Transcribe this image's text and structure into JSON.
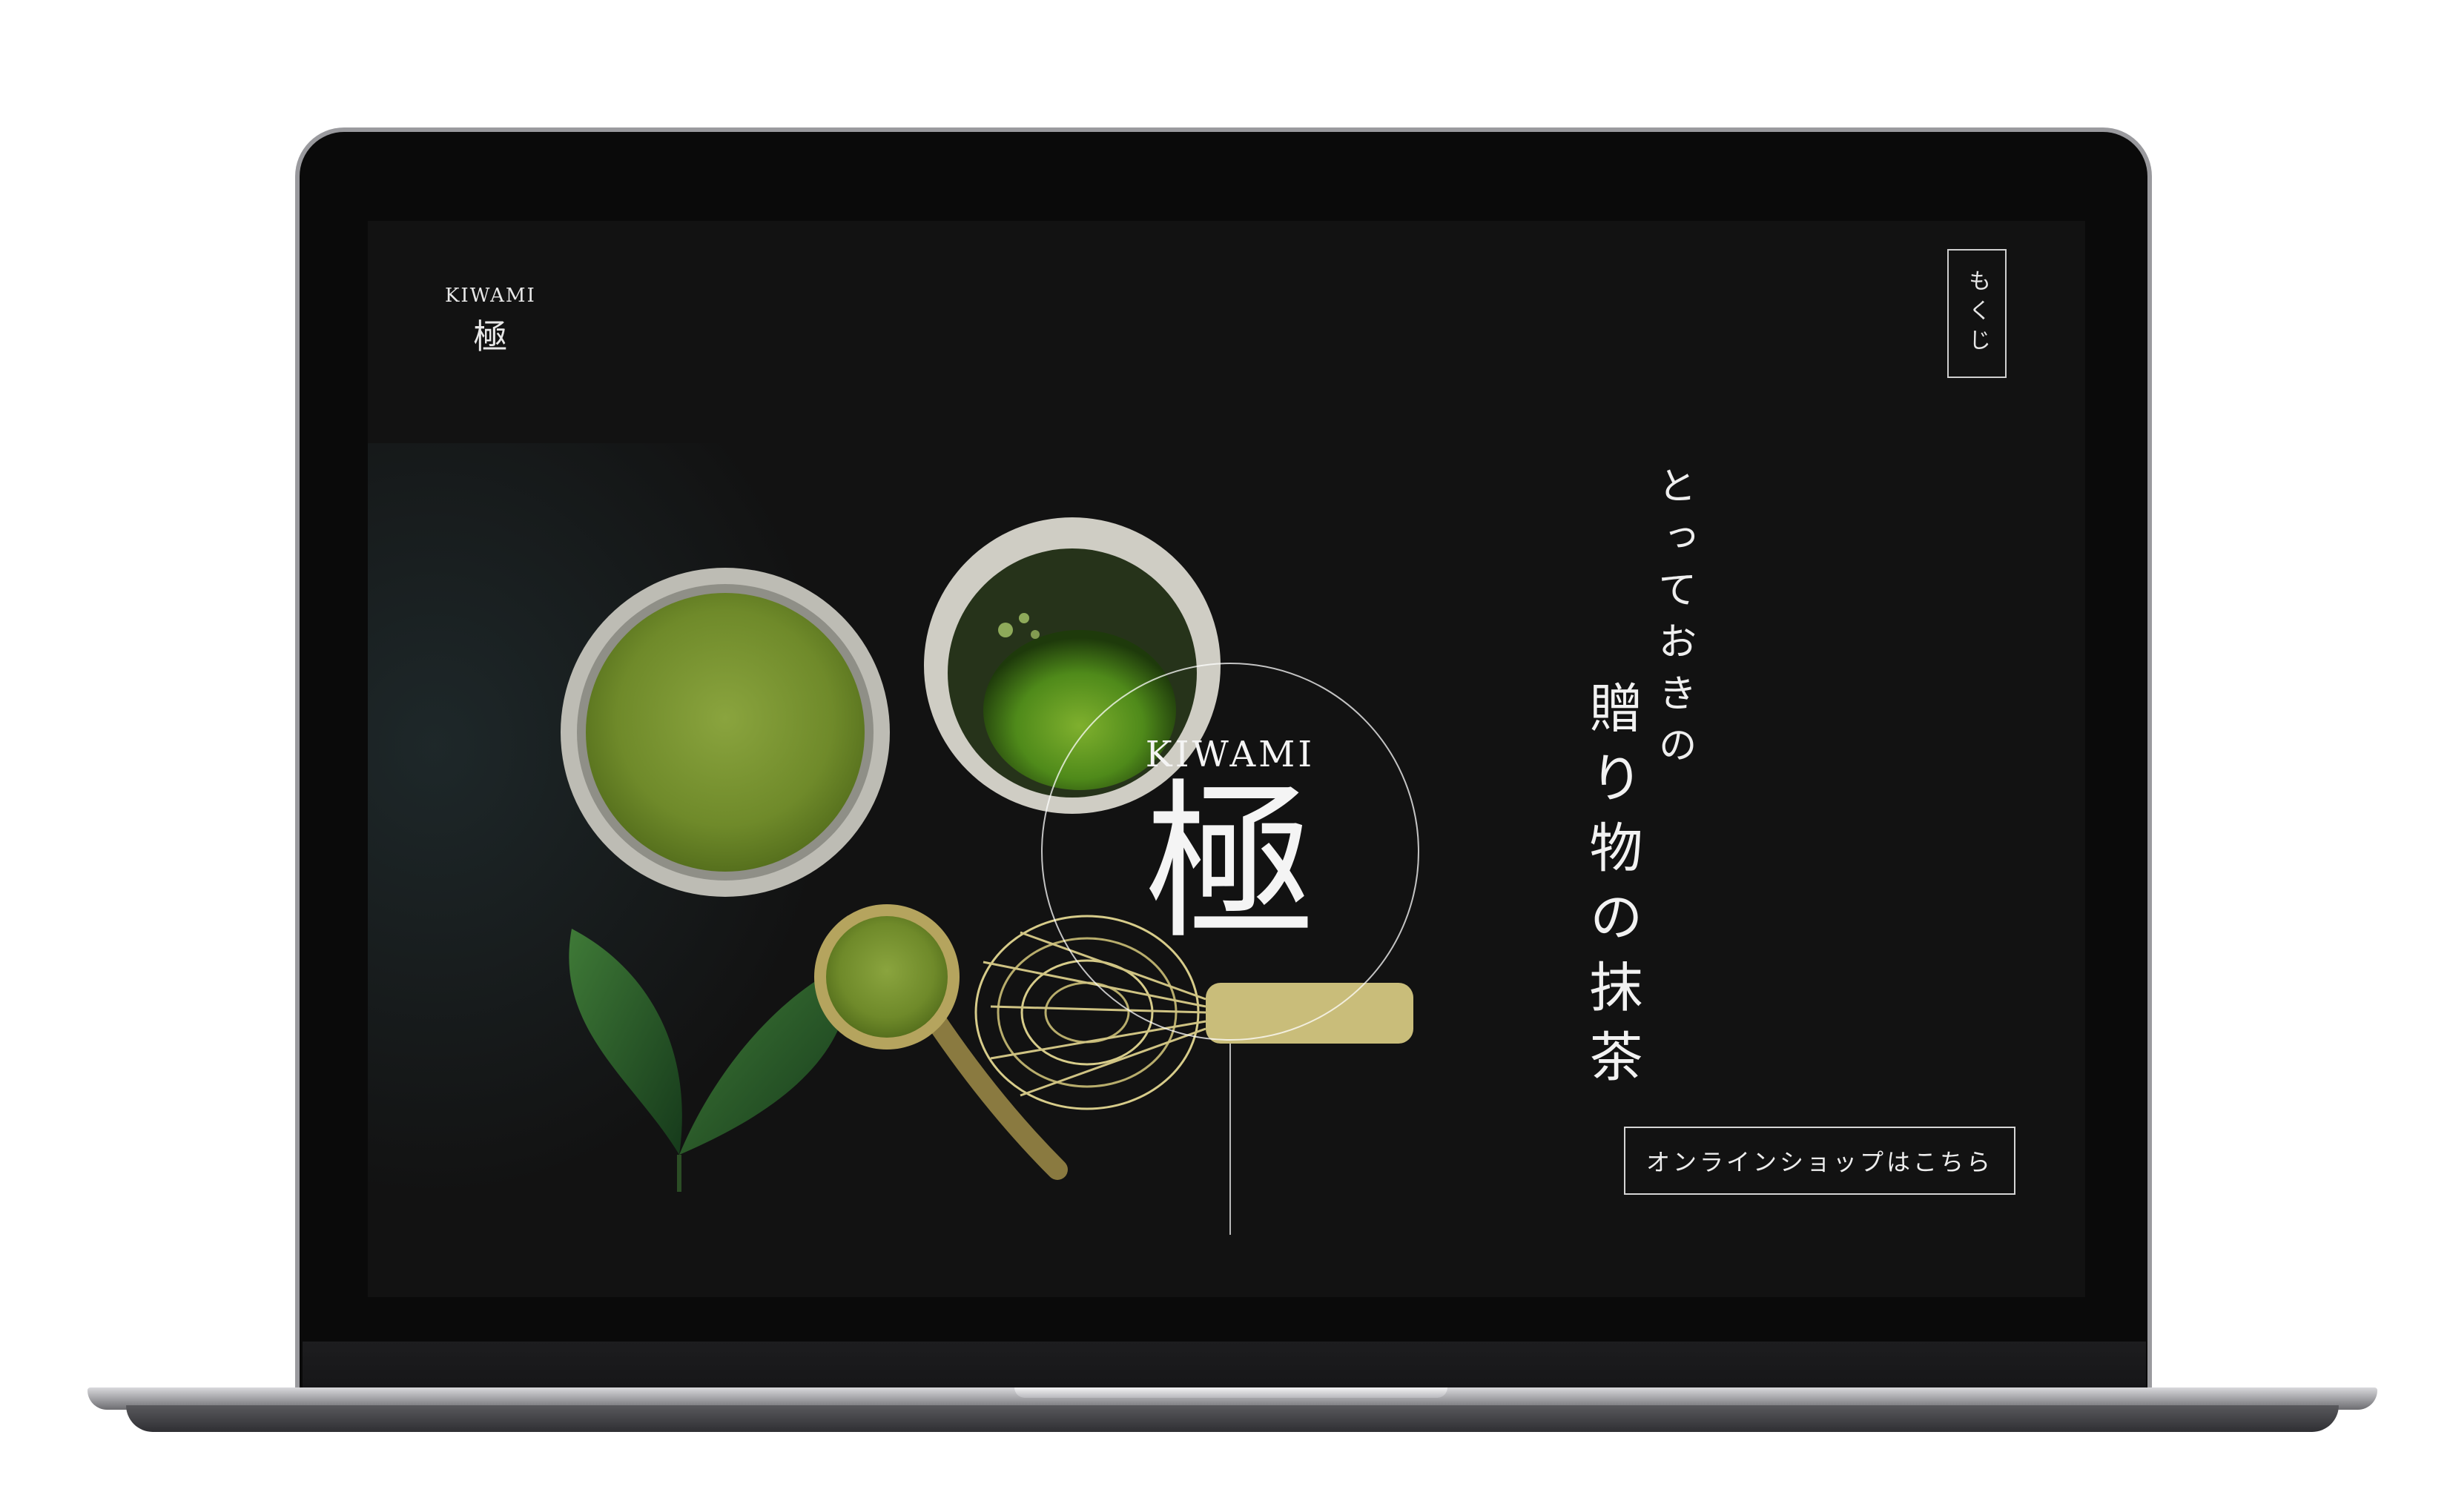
{
  "header": {
    "logo_text": "KIWAMI",
    "logo_kanji": "極",
    "menu_label": "もくじ"
  },
  "hero": {
    "emblem_label": "KIWAMI",
    "emblem_kanji": "極",
    "tagline_sub": "とっておきの",
    "tagline_main": "贈り物の抹茶",
    "shop_button_label": "オンラインショップはこちら"
  },
  "colors": {
    "background": "#121212",
    "matcha_green": "#6f8a2a",
    "text": "#f2f2f2"
  }
}
